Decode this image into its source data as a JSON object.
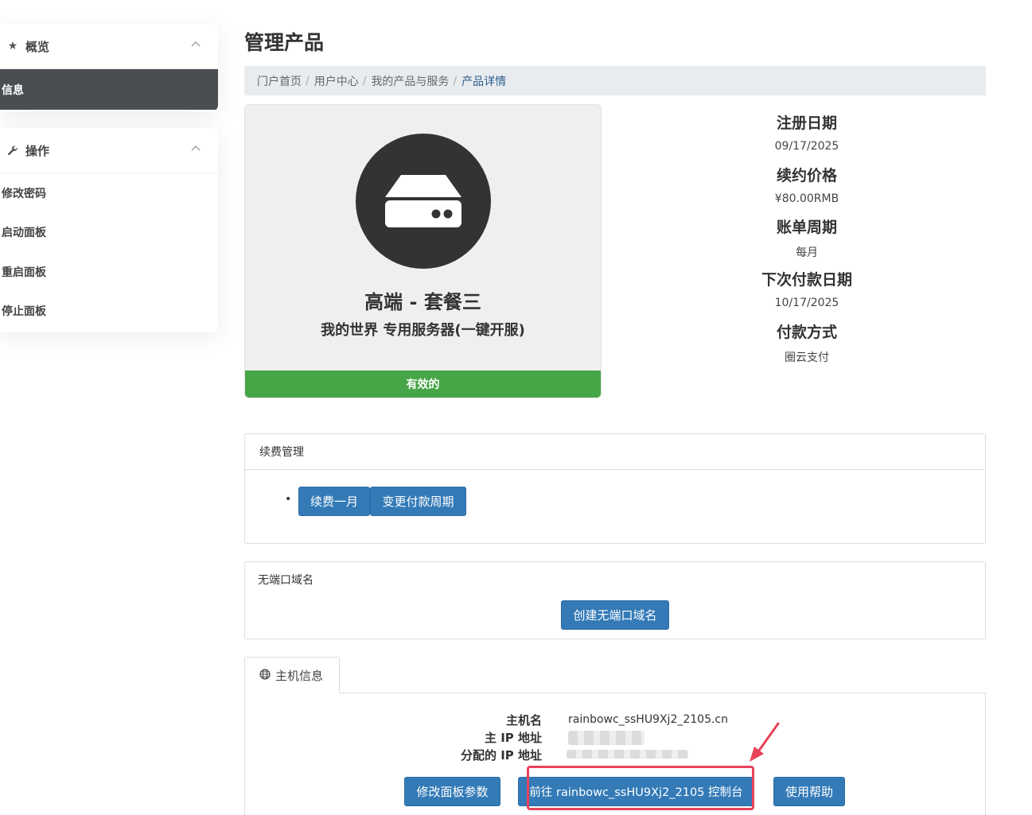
{
  "sidebar": {
    "overview": {
      "title": "概览",
      "icon": "star-icon",
      "active_item": "信息"
    },
    "actions": {
      "title": "操作",
      "icon": "wrench-icon",
      "items": [
        "修改密码",
        "启动面板",
        "重启面板",
        "停止面板"
      ]
    }
  },
  "page": {
    "title": "管理产品"
  },
  "breadcrumb": [
    "门户首页",
    "用户中心",
    "我的产品与服务",
    "产品详情"
  ],
  "product": {
    "name": "高端 - 套餐三",
    "group": "我的世界 专用服务器(一键开服)",
    "status": "有效的",
    "icon": "server-icon"
  },
  "details": [
    {
      "label": "注册日期",
      "value": "09/17/2025"
    },
    {
      "label": "续约价格",
      "value": "¥80.00RMB"
    },
    {
      "label": "账单周期",
      "value": "每月"
    },
    {
      "label": "下次付款日期",
      "value": "10/17/2025"
    },
    {
      "label": "付款方式",
      "value": "圈云支付"
    }
  ],
  "renewal": {
    "title": "续费管理",
    "renew_button": "续费一月",
    "change_cycle_button": "变更付款周期"
  },
  "domain": {
    "title": "无端口域名",
    "create_button": "创建无端口域名"
  },
  "host": {
    "tab": "主机信息",
    "hostname_label": "主机名",
    "hostname_value": "rainbowc_ssHU9Xj2_2105.cn",
    "ip_label": "主 IP 地址",
    "assigned_ip_label": "分配的 IP 地址",
    "edit_params_button": "修改面板参数",
    "console_button": "前往 rainbowc_ssHU9Xj2_2105 控制台",
    "help_button": "使用帮助"
  },
  "colors": {
    "primary": "#337ab7",
    "success": "#46a546",
    "sidebar_active": "#4a4e53",
    "highlight": "#e8435a"
  }
}
